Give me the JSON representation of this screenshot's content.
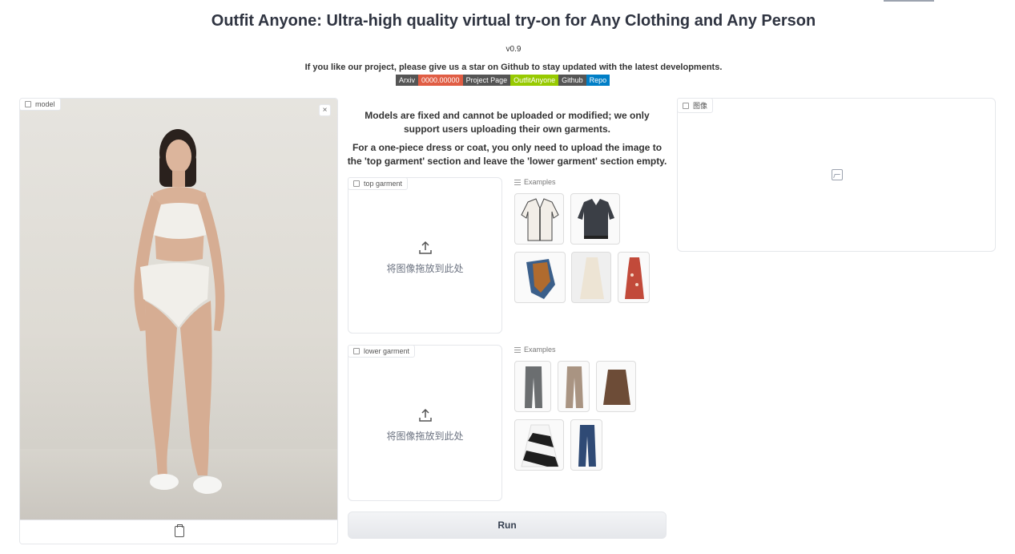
{
  "header": {
    "title": "Outfit Anyone: Ultra-high quality virtual try-on for Any Clothing and Any Person",
    "version": "v0.9",
    "intro": "If you like our project, please give us a star on Github to stay updated with the latest developments."
  },
  "badges": [
    {
      "label": "Arxiv",
      "value": "0000.00000",
      "value_color": "#e05d44"
    },
    {
      "label": "Project Page",
      "value": "OutfitAnyone",
      "value_color": "#97ca00"
    },
    {
      "label": "Github",
      "value": "Repo",
      "value_color": "#007ec6"
    }
  ],
  "model_panel": {
    "label": "model",
    "close_symbol": "×"
  },
  "notice": {
    "line1": "Models are fixed and cannot be uploaded or modified; we only support users uploading their own garments.",
    "line2": "For a one-piece dress or coat, you only need to upload the image to the 'top garment' section and leave the 'lower garment' section empty."
  },
  "top_garment": {
    "label": "top garment",
    "drop_text": "将图像拖放到此处",
    "examples_label": "Examples"
  },
  "lower_garment": {
    "label": "lower garment",
    "drop_text": "将图像拖放到此处",
    "examples_label": "Examples"
  },
  "run_button": "Run",
  "output_panel": {
    "label": "图像"
  }
}
